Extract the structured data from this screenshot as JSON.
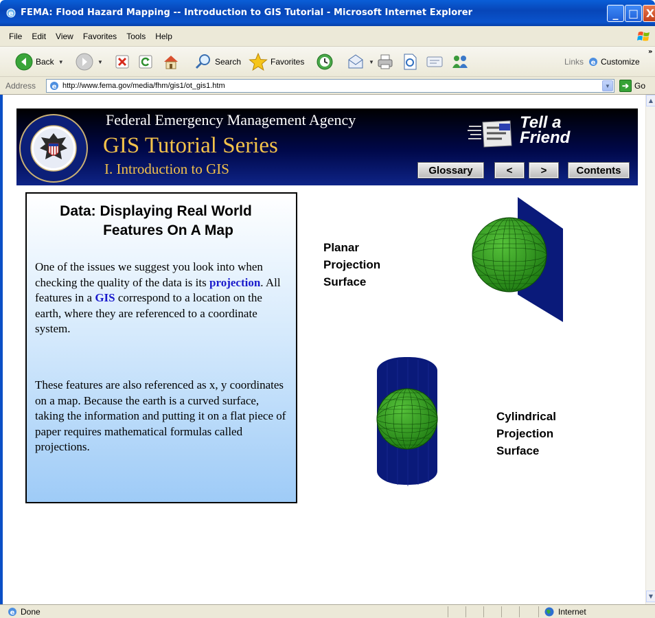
{
  "window": {
    "title": "FEMA: Flood Hazard Mapping -- Introduction to GIS Tutorial - Microsoft Internet Explorer",
    "minimize": "_",
    "maximize": "□",
    "close": "X"
  },
  "menu": [
    "File",
    "Edit",
    "View",
    "Favorites",
    "Tools",
    "Help"
  ],
  "toolbar": {
    "back": "Back",
    "search": "Search",
    "favorites": "Favorites",
    "links": "Links",
    "customize": "Customize",
    "more": "»"
  },
  "address": {
    "label": "Address",
    "url": "http://www.fema.gov/media/fhm/gis1/ot_gis1.htm",
    "go": "Go"
  },
  "banner": {
    "agency": "Federal Emergency Management Agency",
    "series": "GIS Tutorial Series",
    "section": "I. Introduction to GIS",
    "tell_line1": "Tell a",
    "tell_line2": "Friend",
    "buttons": {
      "glossary": "Glossary",
      "prev": "<",
      "next": ">",
      "contents": "Contents"
    },
    "seal_text": "FEDERAL EMERGENCY MANAGEMENT AGENCY"
  },
  "panel": {
    "heading_line1": "Data: Displaying Real World",
    "heading_line2": "Features On A Map",
    "p1_a": "One of the issues we suggest you look into when checking the quality of the data is its ",
    "p1_link1": "projection",
    "p1_b": ".  All features in a ",
    "p1_link2": "GIS",
    "p1_c": " correspond to a location on the earth, where they are referenced to a coordinate system.",
    "p2": "These features are also referenced as x, y coordinates on a map.  Because the earth is a curved surface, taking the information and putting it on a flat piece of paper requires mathematical formulas called projections."
  },
  "figures": {
    "planar_label": [
      "Planar",
      "Projection",
      "Surface"
    ],
    "cyl_label": [
      "Cylindrical",
      "Projection",
      "Surface"
    ],
    "globe_color": "#2e9a1e",
    "surface_color": "#0a1a7a"
  },
  "status": {
    "left": "Done",
    "zone": "Internet"
  }
}
